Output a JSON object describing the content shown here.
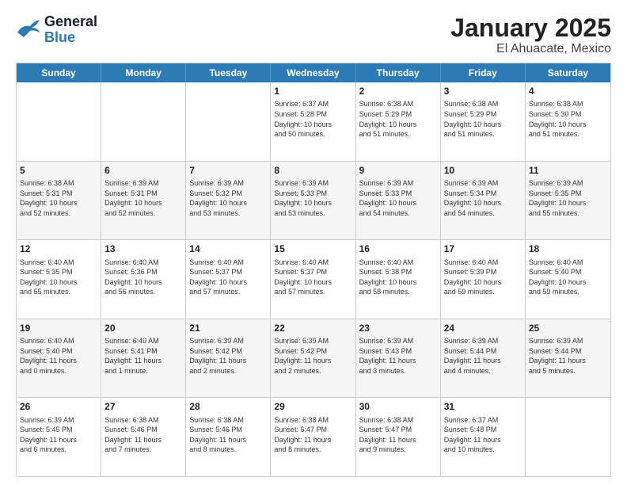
{
  "logo": {
    "line1": "General",
    "line2": "Blue"
  },
  "title": "January 2025",
  "subtitle": "El Ahuacate, Mexico",
  "header_days": [
    "Sunday",
    "Monday",
    "Tuesday",
    "Wednesday",
    "Thursday",
    "Friday",
    "Saturday"
  ],
  "weeks": [
    [
      {
        "day": "",
        "info": ""
      },
      {
        "day": "",
        "info": ""
      },
      {
        "day": "",
        "info": ""
      },
      {
        "day": "1",
        "info": "Sunrise: 6:37 AM\nSunset: 5:28 PM\nDaylight: 10 hours\nand 50 minutes."
      },
      {
        "day": "2",
        "info": "Sunrise: 6:38 AM\nSunset: 5:29 PM\nDaylight: 10 hours\nand 51 minutes."
      },
      {
        "day": "3",
        "info": "Sunrise: 6:38 AM\nSunset: 5:29 PM\nDaylight: 10 hours\nand 51 minutes."
      },
      {
        "day": "4",
        "info": "Sunrise: 6:38 AM\nSunset: 5:30 PM\nDaylight: 10 hours\nand 51 minutes."
      }
    ],
    [
      {
        "day": "5",
        "info": "Sunrise: 6:38 AM\nSunset: 5:31 PM\nDaylight: 10 hours\nand 52 minutes."
      },
      {
        "day": "6",
        "info": "Sunrise: 6:39 AM\nSunset: 5:31 PM\nDaylight: 10 hours\nand 52 minutes."
      },
      {
        "day": "7",
        "info": "Sunrise: 6:39 AM\nSunset: 5:32 PM\nDaylight: 10 hours\nand 53 minutes."
      },
      {
        "day": "8",
        "info": "Sunrise: 6:39 AM\nSunset: 5:33 PM\nDaylight: 10 hours\nand 53 minutes."
      },
      {
        "day": "9",
        "info": "Sunrise: 6:39 AM\nSunset: 5:33 PM\nDaylight: 10 hours\nand 54 minutes."
      },
      {
        "day": "10",
        "info": "Sunrise: 6:39 AM\nSunset: 5:34 PM\nDaylight: 10 hours\nand 54 minutes."
      },
      {
        "day": "11",
        "info": "Sunrise: 6:39 AM\nSunset: 5:35 PM\nDaylight: 10 hours\nand 55 minutes."
      }
    ],
    [
      {
        "day": "12",
        "info": "Sunrise: 6:40 AM\nSunset: 5:35 PM\nDaylight: 10 hours\nand 55 minutes."
      },
      {
        "day": "13",
        "info": "Sunrise: 6:40 AM\nSunset: 5:36 PM\nDaylight: 10 hours\nand 56 minutes."
      },
      {
        "day": "14",
        "info": "Sunrise: 6:40 AM\nSunset: 5:37 PM\nDaylight: 10 hours\nand 57 minutes."
      },
      {
        "day": "15",
        "info": "Sunrise: 6:40 AM\nSunset: 5:37 PM\nDaylight: 10 hours\nand 57 minutes."
      },
      {
        "day": "16",
        "info": "Sunrise: 6:40 AM\nSunset: 5:38 PM\nDaylight: 10 hours\nand 58 minutes."
      },
      {
        "day": "17",
        "info": "Sunrise: 6:40 AM\nSunset: 5:39 PM\nDaylight: 10 hours\nand 59 minutes."
      },
      {
        "day": "18",
        "info": "Sunrise: 6:40 AM\nSunset: 5:40 PM\nDaylight: 10 hours\nand 59 minutes."
      }
    ],
    [
      {
        "day": "19",
        "info": "Sunrise: 6:40 AM\nSunset: 5:40 PM\nDaylight: 11 hours\nand 0 minutes."
      },
      {
        "day": "20",
        "info": "Sunrise: 6:40 AM\nSunset: 5:41 PM\nDaylight: 11 hours\nand 1 minute."
      },
      {
        "day": "21",
        "info": "Sunrise: 6:39 AM\nSunset: 5:42 PM\nDaylight: 11 hours\nand 2 minutes."
      },
      {
        "day": "22",
        "info": "Sunrise: 6:39 AM\nSunset: 5:42 PM\nDaylight: 11 hours\nand 2 minutes."
      },
      {
        "day": "23",
        "info": "Sunrise: 6:39 AM\nSunset: 5:43 PM\nDaylight: 11 hours\nand 3 minutes."
      },
      {
        "day": "24",
        "info": "Sunrise: 6:39 AM\nSunset: 5:44 PM\nDaylight: 11 hours\nand 4 minutes."
      },
      {
        "day": "25",
        "info": "Sunrise: 6:39 AM\nSunset: 5:44 PM\nDaylight: 11 hours\nand 5 minutes."
      }
    ],
    [
      {
        "day": "26",
        "info": "Sunrise: 6:39 AM\nSunset: 5:45 PM\nDaylight: 11 hours\nand 6 minutes."
      },
      {
        "day": "27",
        "info": "Sunrise: 6:38 AM\nSunset: 5:46 PM\nDaylight: 11 hours\nand 7 minutes."
      },
      {
        "day": "28",
        "info": "Sunrise: 6:38 AM\nSunset: 5:46 PM\nDaylight: 11 hours\nand 8 minutes."
      },
      {
        "day": "29",
        "info": "Sunrise: 6:38 AM\nSunset: 5:47 PM\nDaylight: 11 hours\nand 8 minutes."
      },
      {
        "day": "30",
        "info": "Sunrise: 6:38 AM\nSunset: 5:47 PM\nDaylight: 11 hours\nand 9 minutes."
      },
      {
        "day": "31",
        "info": "Sunrise: 6:37 AM\nSunset: 5:48 PM\nDaylight: 11 hours\nand 10 minutes."
      },
      {
        "day": "",
        "info": ""
      }
    ]
  ]
}
